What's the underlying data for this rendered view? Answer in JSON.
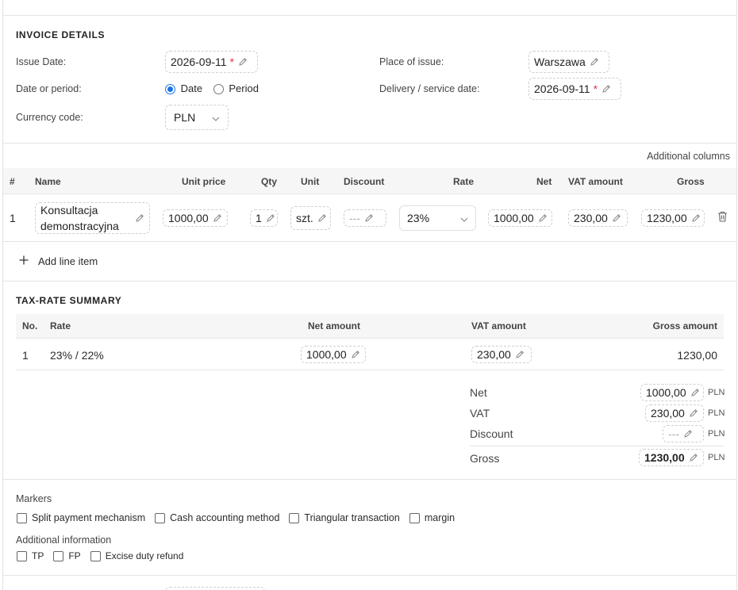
{
  "invoice_details": {
    "title": "INVOICE DETAILS",
    "issue_date_label": "Issue Date:",
    "issue_date": "2026-09-11",
    "required_mark": "*",
    "place_of_issue_label": "Place of issue:",
    "place_of_issue": "Warszawa",
    "date_or_period_label": "Date or period:",
    "opt_date": "Date",
    "opt_period": "Period",
    "delivery_date_label": "Delivery / service date:",
    "delivery_date": "2026-09-11",
    "currency_label": "Currency code:",
    "currency": "PLN"
  },
  "line_items": {
    "additional_columns": "Additional columns",
    "headers": [
      "#",
      "Name",
      "Unit price",
      "Qty",
      "Unit",
      "Discount",
      "Rate",
      "Net",
      "VAT amount",
      "Gross"
    ],
    "row": {
      "no": "1",
      "name_line1": "Konsultacja",
      "name_line2": "demonstracyjna",
      "unit_price": "1000,00",
      "qty": "1",
      "unit": "szt.",
      "discount": "---",
      "rate": "23%",
      "net": "1000,00",
      "vat": "230,00",
      "gross": "1230,00"
    },
    "add_label": "Add line item"
  },
  "tax_summary": {
    "title": "TAX-RATE SUMMARY",
    "headers": [
      "No.",
      "Rate",
      "Net amount",
      "VAT amount",
      "Gross amount"
    ],
    "row": {
      "no": "1",
      "rate": "23% / 22%",
      "net": "1000,00",
      "vat": "230,00",
      "gross": "1230,00"
    },
    "totals": {
      "net_label": "Net",
      "net": "1000,00",
      "vat_label": "VAT",
      "vat": "230,00",
      "discount_label": "Discount",
      "discount": "---",
      "gross_label": "Gross",
      "gross": "1230,00",
      "currency": "PLN"
    }
  },
  "markers": {
    "title": "Markers",
    "items": [
      "Split payment mechanism",
      "Cash accounting method",
      "Triangular transaction",
      "margin"
    ],
    "additional_title": "Additional information",
    "additional_items": [
      "TP",
      "FP",
      "Excise duty refund"
    ]
  },
  "colors": {
    "accent": "#1a73e8",
    "required": "#e0334a",
    "border": "#e3e3e3",
    "header_bg": "#f6f6f6"
  }
}
